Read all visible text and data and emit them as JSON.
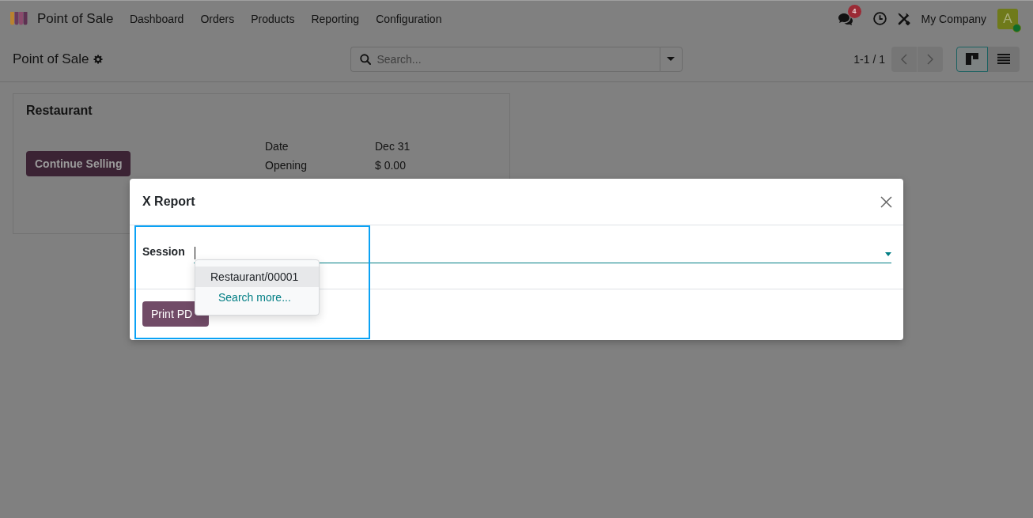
{
  "navbar": {
    "app_name": "Point of Sale",
    "menu": [
      "Dashboard",
      "Orders",
      "Products",
      "Reporting",
      "Configuration"
    ],
    "messages_badge": "4",
    "company": "My Company",
    "avatar": {
      "initial": "A",
      "online": true
    }
  },
  "control_panel": {
    "breadcrumb": "Point of Sale",
    "search": {
      "placeholder": "Search..."
    },
    "pager": "1-1 / 1",
    "views": [
      {
        "kind": "kanban",
        "selected": true
      },
      {
        "kind": "list",
        "selected": false
      }
    ]
  },
  "cards": [
    {
      "title": "Restaurant",
      "button": "Continue Selling",
      "stats": [
        {
          "label": "Date",
          "value": "Dec 31"
        },
        {
          "label": "Opening",
          "value": "$ 0.00"
        }
      ]
    }
  ],
  "dialog": {
    "title": "X Report",
    "fields": [
      {
        "label": "Session",
        "focused": true
      }
    ],
    "dropdown": {
      "options": [
        {
          "kind": "record",
          "label": "Restaurant/00001",
          "selected": true
        },
        {
          "kind": "action",
          "label": "Search more...",
          "selected": false
        }
      ]
    },
    "buttons": [
      {
        "kind": "primary",
        "label": "Print PD"
      }
    ]
  },
  "highlight": {
    "kind": "frame"
  }
}
